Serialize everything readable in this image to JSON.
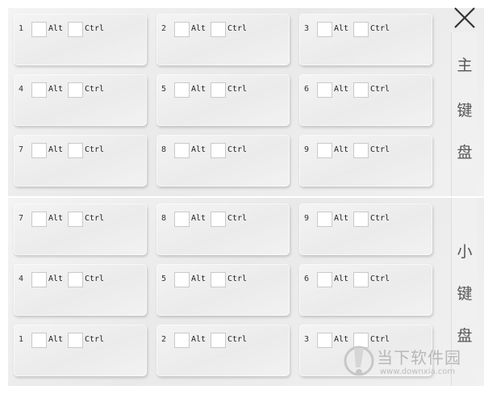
{
  "close": {
    "icon": "close-icon"
  },
  "labels": {
    "alt": "Alt",
    "ctrl": "Ctrl"
  },
  "main_keyboard": {
    "title_chars": [
      "主",
      "键",
      "盘"
    ],
    "keys": [
      "1",
      "2",
      "3",
      "4",
      "5",
      "6",
      "7",
      "8",
      "9"
    ]
  },
  "numpad": {
    "title_chars": [
      "小",
      "键",
      "盘"
    ],
    "keys": [
      "7",
      "8",
      "9",
      "4",
      "5",
      "6",
      "1",
      "2",
      "3"
    ]
  },
  "watermark": {
    "title": "当下软件园",
    "url": "www.downxia.com"
  }
}
